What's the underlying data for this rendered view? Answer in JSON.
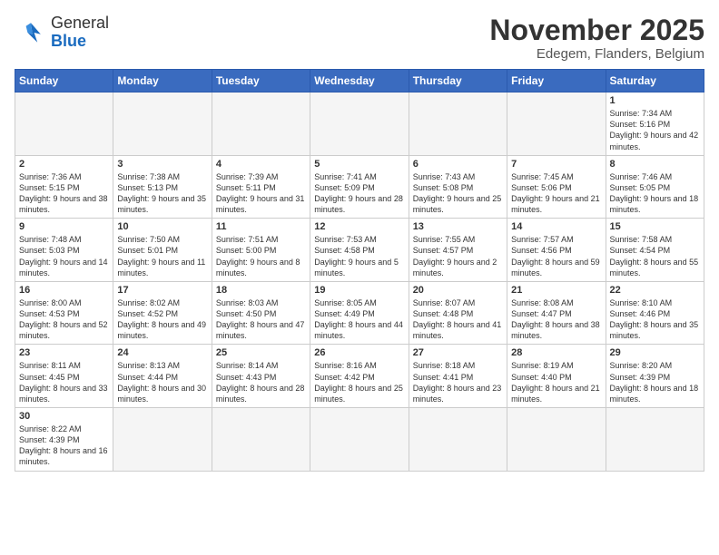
{
  "header": {
    "logo_general": "General",
    "logo_blue": "Blue",
    "month_year": "November 2025",
    "location": "Edegem, Flanders, Belgium"
  },
  "days_of_week": [
    "Sunday",
    "Monday",
    "Tuesday",
    "Wednesday",
    "Thursday",
    "Friday",
    "Saturday"
  ],
  "weeks": [
    [
      {
        "day": "",
        "info": ""
      },
      {
        "day": "",
        "info": ""
      },
      {
        "day": "",
        "info": ""
      },
      {
        "day": "",
        "info": ""
      },
      {
        "day": "",
        "info": ""
      },
      {
        "day": "",
        "info": ""
      },
      {
        "day": "1",
        "info": "Sunrise: 7:34 AM\nSunset: 5:16 PM\nDaylight: 9 hours and 42 minutes."
      }
    ],
    [
      {
        "day": "2",
        "info": "Sunrise: 7:36 AM\nSunset: 5:15 PM\nDaylight: 9 hours and 38 minutes."
      },
      {
        "day": "3",
        "info": "Sunrise: 7:38 AM\nSunset: 5:13 PM\nDaylight: 9 hours and 35 minutes."
      },
      {
        "day": "4",
        "info": "Sunrise: 7:39 AM\nSunset: 5:11 PM\nDaylight: 9 hours and 31 minutes."
      },
      {
        "day": "5",
        "info": "Sunrise: 7:41 AM\nSunset: 5:09 PM\nDaylight: 9 hours and 28 minutes."
      },
      {
        "day": "6",
        "info": "Sunrise: 7:43 AM\nSunset: 5:08 PM\nDaylight: 9 hours and 25 minutes."
      },
      {
        "day": "7",
        "info": "Sunrise: 7:45 AM\nSunset: 5:06 PM\nDaylight: 9 hours and 21 minutes."
      },
      {
        "day": "8",
        "info": "Sunrise: 7:46 AM\nSunset: 5:05 PM\nDaylight: 9 hours and 18 minutes."
      }
    ],
    [
      {
        "day": "9",
        "info": "Sunrise: 7:48 AM\nSunset: 5:03 PM\nDaylight: 9 hours and 14 minutes."
      },
      {
        "day": "10",
        "info": "Sunrise: 7:50 AM\nSunset: 5:01 PM\nDaylight: 9 hours and 11 minutes."
      },
      {
        "day": "11",
        "info": "Sunrise: 7:51 AM\nSunset: 5:00 PM\nDaylight: 9 hours and 8 minutes."
      },
      {
        "day": "12",
        "info": "Sunrise: 7:53 AM\nSunset: 4:58 PM\nDaylight: 9 hours and 5 minutes."
      },
      {
        "day": "13",
        "info": "Sunrise: 7:55 AM\nSunset: 4:57 PM\nDaylight: 9 hours and 2 minutes."
      },
      {
        "day": "14",
        "info": "Sunrise: 7:57 AM\nSunset: 4:56 PM\nDaylight: 8 hours and 59 minutes."
      },
      {
        "day": "15",
        "info": "Sunrise: 7:58 AM\nSunset: 4:54 PM\nDaylight: 8 hours and 55 minutes."
      }
    ],
    [
      {
        "day": "16",
        "info": "Sunrise: 8:00 AM\nSunset: 4:53 PM\nDaylight: 8 hours and 52 minutes."
      },
      {
        "day": "17",
        "info": "Sunrise: 8:02 AM\nSunset: 4:52 PM\nDaylight: 8 hours and 49 minutes."
      },
      {
        "day": "18",
        "info": "Sunrise: 8:03 AM\nSunset: 4:50 PM\nDaylight: 8 hours and 47 minutes."
      },
      {
        "day": "19",
        "info": "Sunrise: 8:05 AM\nSunset: 4:49 PM\nDaylight: 8 hours and 44 minutes."
      },
      {
        "day": "20",
        "info": "Sunrise: 8:07 AM\nSunset: 4:48 PM\nDaylight: 8 hours and 41 minutes."
      },
      {
        "day": "21",
        "info": "Sunrise: 8:08 AM\nSunset: 4:47 PM\nDaylight: 8 hours and 38 minutes."
      },
      {
        "day": "22",
        "info": "Sunrise: 8:10 AM\nSunset: 4:46 PM\nDaylight: 8 hours and 35 minutes."
      }
    ],
    [
      {
        "day": "23",
        "info": "Sunrise: 8:11 AM\nSunset: 4:45 PM\nDaylight: 8 hours and 33 minutes."
      },
      {
        "day": "24",
        "info": "Sunrise: 8:13 AM\nSunset: 4:44 PM\nDaylight: 8 hours and 30 minutes."
      },
      {
        "day": "25",
        "info": "Sunrise: 8:14 AM\nSunset: 4:43 PM\nDaylight: 8 hours and 28 minutes."
      },
      {
        "day": "26",
        "info": "Sunrise: 8:16 AM\nSunset: 4:42 PM\nDaylight: 8 hours and 25 minutes."
      },
      {
        "day": "27",
        "info": "Sunrise: 8:18 AM\nSunset: 4:41 PM\nDaylight: 8 hours and 23 minutes."
      },
      {
        "day": "28",
        "info": "Sunrise: 8:19 AM\nSunset: 4:40 PM\nDaylight: 8 hours and 21 minutes."
      },
      {
        "day": "29",
        "info": "Sunrise: 8:20 AM\nSunset: 4:39 PM\nDaylight: 8 hours and 18 minutes."
      }
    ],
    [
      {
        "day": "30",
        "info": "Sunrise: 8:22 AM\nSunset: 4:39 PM\nDaylight: 8 hours and 16 minutes."
      },
      {
        "day": "",
        "info": ""
      },
      {
        "day": "",
        "info": ""
      },
      {
        "day": "",
        "info": ""
      },
      {
        "day": "",
        "info": ""
      },
      {
        "day": "",
        "info": ""
      },
      {
        "day": "",
        "info": ""
      }
    ]
  ]
}
